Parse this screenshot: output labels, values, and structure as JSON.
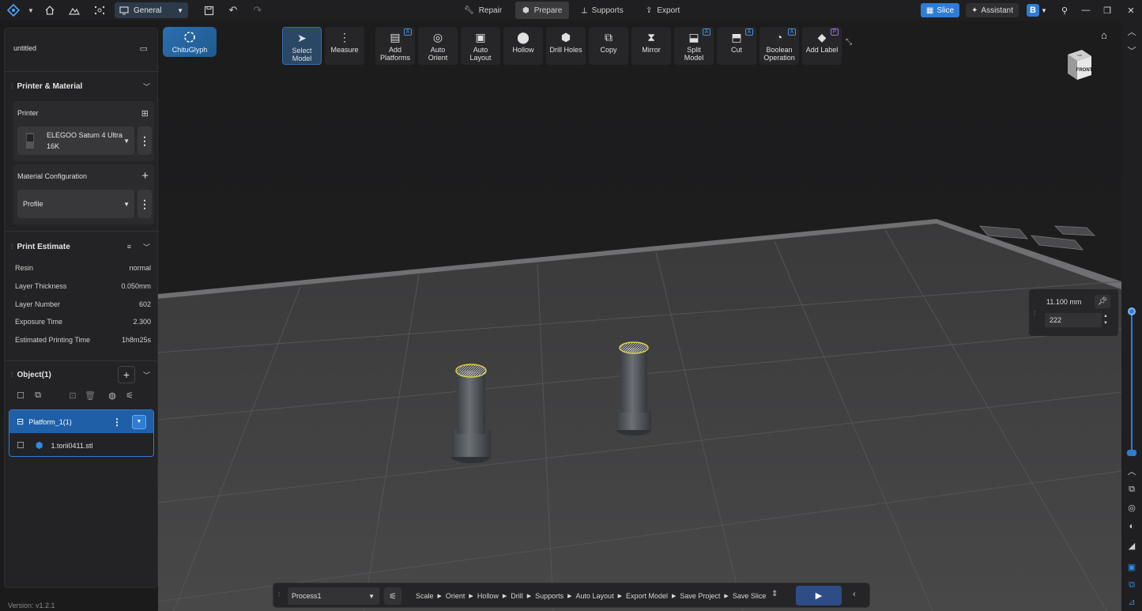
{
  "topbar": {
    "workspace_label": "General",
    "tabs": [
      {
        "label": "Repair",
        "active": false
      },
      {
        "label": "Prepare",
        "active": true
      },
      {
        "label": "Supports",
        "active": false
      },
      {
        "label": "Export",
        "active": false
      }
    ],
    "slice_label": "Slice",
    "assistant_label": "Assistant",
    "b_label": "B"
  },
  "brand": {
    "chitu_label": "ChituGlyph"
  },
  "toolbar": [
    {
      "id": "select-model",
      "label1": "Select",
      "label2": "Model",
      "icon": "cursor-icon",
      "glyph": "➤",
      "active": true,
      "badge": ""
    },
    {
      "id": "measure",
      "label1": "Measure",
      "label2": "",
      "icon": "measure-icon",
      "glyph": "⋮",
      "active": false,
      "badge": ""
    },
    {
      "id": "add-platforms",
      "label1": "Add",
      "label2": "Platforms",
      "icon": "add-platform-icon",
      "glyph": "▤",
      "active": false,
      "badge": "A"
    },
    {
      "id": "auto-orient",
      "label1": "Auto",
      "label2": "Orient",
      "icon": "orient-icon",
      "glyph": "◎",
      "active": false,
      "badge": ""
    },
    {
      "id": "auto-layout",
      "label1": "Auto",
      "label2": "Layout",
      "icon": "layout-icon",
      "glyph": "▣",
      "active": false,
      "badge": ""
    },
    {
      "id": "hollow",
      "label1": "Hollow",
      "label2": "",
      "icon": "hollow-icon",
      "glyph": "⬤",
      "active": false,
      "badge": ""
    },
    {
      "id": "drill-holes",
      "label1": "Drill Holes",
      "label2": "",
      "icon": "drill-icon",
      "glyph": "⬢",
      "active": false,
      "badge": ""
    },
    {
      "id": "copy",
      "label1": "Copy",
      "label2": "",
      "icon": "copy-icon",
      "glyph": "⧉",
      "active": false,
      "badge": ""
    },
    {
      "id": "mirror",
      "label1": "Mirror",
      "label2": "",
      "icon": "mirror-icon",
      "glyph": "⧗",
      "active": false,
      "badge": ""
    },
    {
      "id": "split-model",
      "label1": "Split",
      "label2": "Model",
      "icon": "split-icon",
      "glyph": "⬓",
      "active": false,
      "badge": "A"
    },
    {
      "id": "cut",
      "label1": "Cut",
      "label2": "",
      "icon": "cut-icon",
      "glyph": "⬒",
      "active": false,
      "badge": "A"
    },
    {
      "id": "boolean-operation",
      "label1": "Boolean",
      "label2": "Operation",
      "icon": "boolean-icon",
      "glyph": "◔",
      "active": false,
      "badge": "A"
    },
    {
      "id": "add-label",
      "label1": "Add Label",
      "label2": "",
      "icon": "label-icon",
      "glyph": "◆",
      "active": false,
      "badge": "P"
    }
  ],
  "leftpanel": {
    "project_name": "untitled",
    "printer_material_title": "Printer & Material",
    "printer_label": "Printer",
    "printer_name_line1": "ELEGOO Saturn 4 Ultra",
    "printer_name_line2": "16K",
    "material_config_label": "Material Configuration",
    "profile_label": "Profile",
    "print_estimate_title": "Print Estimate",
    "estimates": [
      {
        "label": "Resin",
        "value": "normal"
      },
      {
        "label": "Layer Thickness",
        "value": "0.050mm"
      },
      {
        "label": "Layer Number",
        "value": "602"
      },
      {
        "label": "Exposure Time",
        "value": "2.300"
      },
      {
        "label": "Estimated Printing Time",
        "value": "1h8m25s"
      }
    ],
    "object_title": "Object(1)",
    "platform_name": "Platform_1(1)",
    "file_name": "1.torii0411.stl"
  },
  "layer": {
    "height_mm": "11.100 mm",
    "layer_value": "222",
    "slider_top_fraction": 0.0,
    "slider_bottom_fraction": 1.0
  },
  "viewcube": {
    "face_label": "FRONT",
    "top_label": "TOP"
  },
  "processbar": {
    "process_label": "Process1",
    "steps": [
      "Scale",
      "Orient",
      "Hollow",
      "Drill",
      "Supports",
      "Auto Layout",
      "Export Model",
      "Save Project",
      "Save Slice"
    ]
  },
  "version": "Version: v1.2.1"
}
